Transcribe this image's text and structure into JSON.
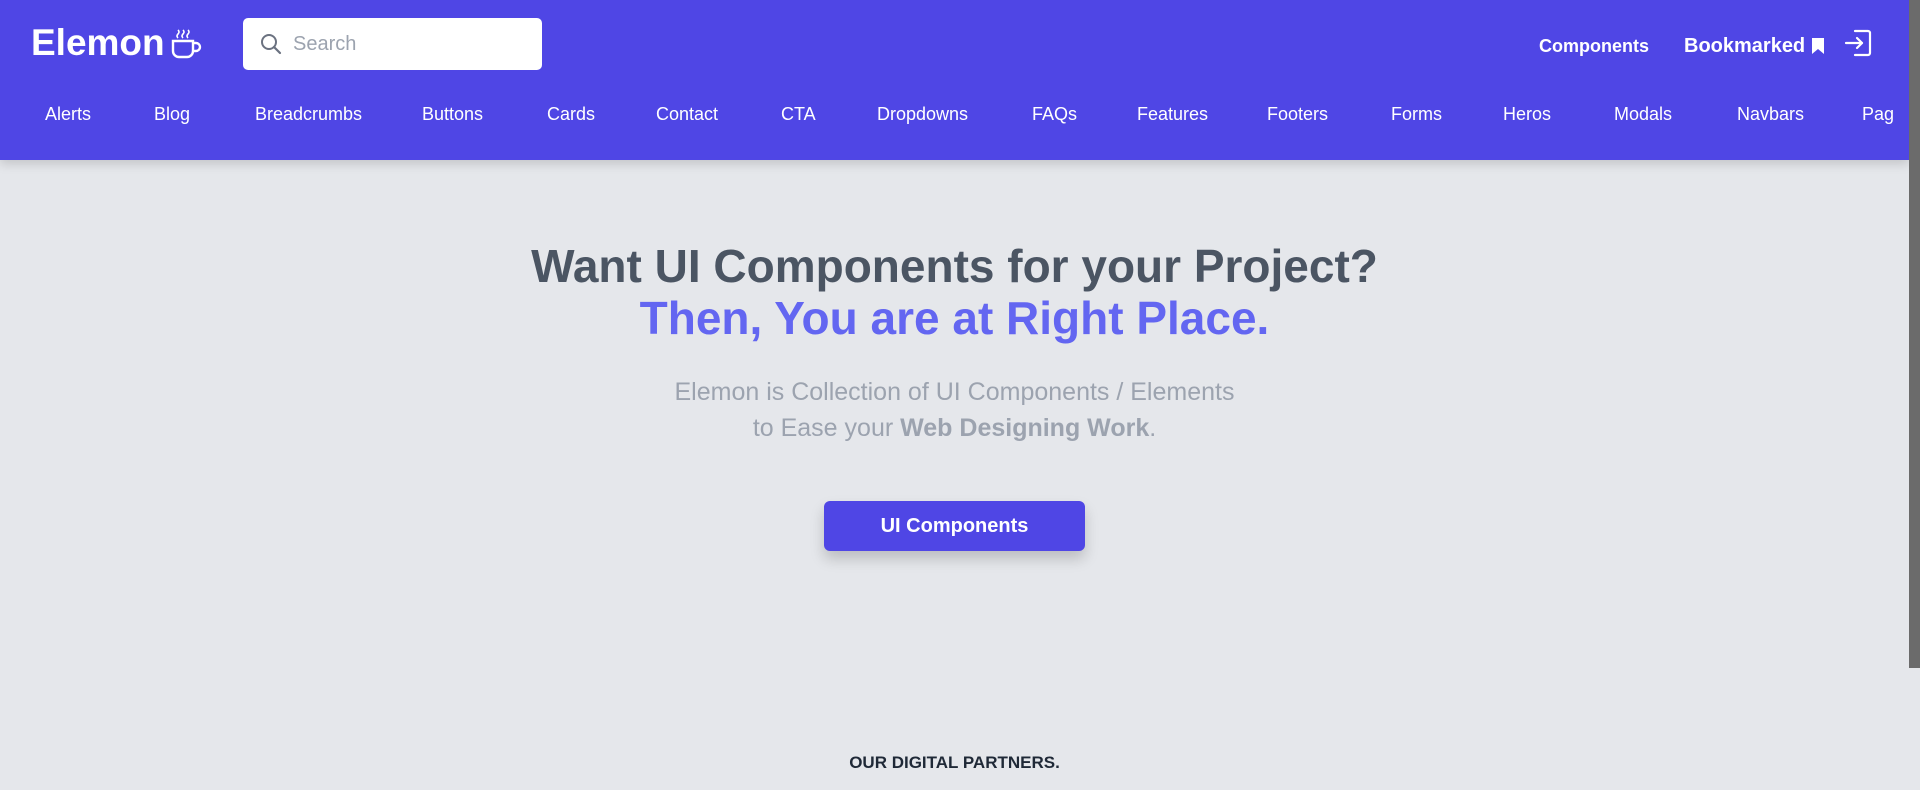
{
  "brand": {
    "name": "Elemon"
  },
  "search": {
    "placeholder": "Search",
    "value": ""
  },
  "top_nav": {
    "components": "Components",
    "bookmarked": "Bookmarked"
  },
  "categories": [
    "Alerts",
    "Blog",
    "Breadcrumbs",
    "Buttons",
    "Cards",
    "Contact",
    "CTA",
    "Dropdowns",
    "FAQs",
    "Features",
    "Footers",
    "Forms",
    "Heros",
    "Modals",
    "Navbars",
    "Pag"
  ],
  "hero": {
    "title_line1": "Want UI Components for your Project?",
    "title_line2": "Then, You are at Right Place.",
    "sub_line1": "Elemon is Collection of UI Components / Elements",
    "sub_line2_prefix": "to Ease your ",
    "sub_line2_bold": "Web Designing Work",
    "sub_line2_suffix": ".",
    "cta_label": "UI Components"
  },
  "partners": {
    "heading": "OUR DIGITAL PARTNERS."
  },
  "colors": {
    "brand": "#4f46e5",
    "accent_text": "#6366f1",
    "page_bg": "#e5e7eb",
    "heading": "#4b5563",
    "muted": "#9ca3af"
  }
}
